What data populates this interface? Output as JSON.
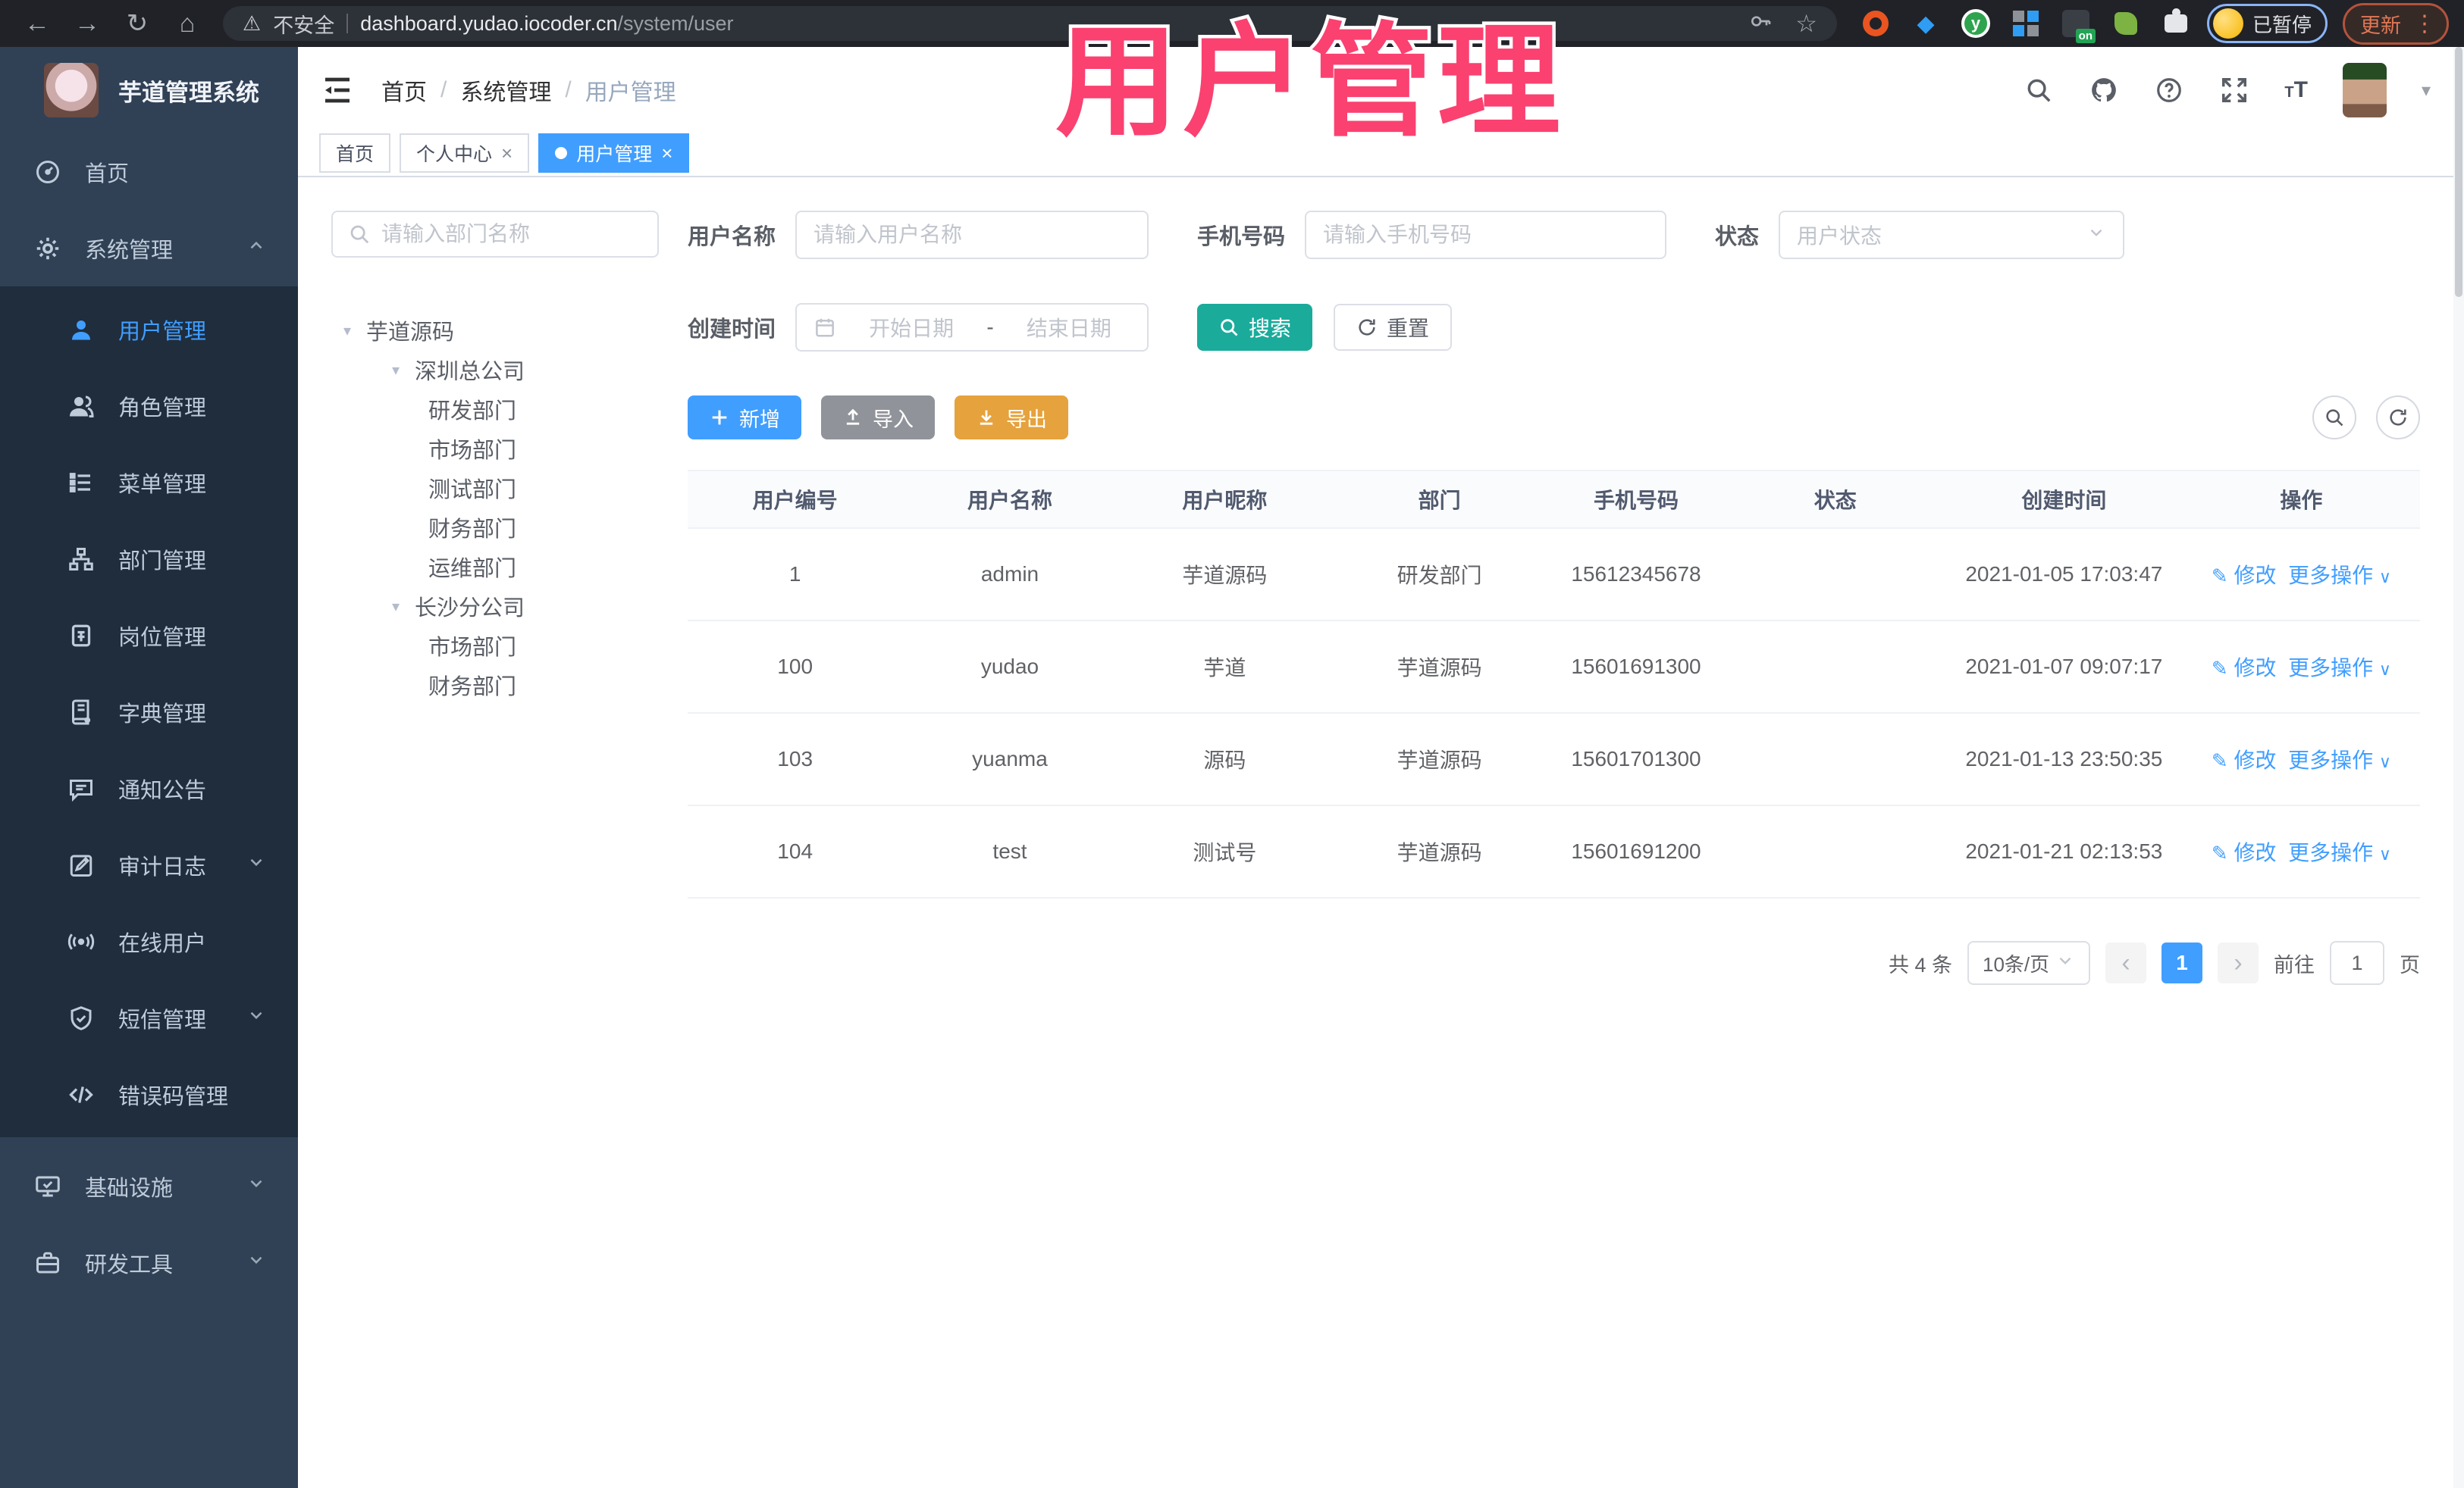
{
  "colors": {
    "accent": "#409EFF",
    "search_teal": "#1AAB9B",
    "export_orange": "#E6A23C",
    "import_gray": "#909399",
    "overlay_pink": "#FA4170",
    "sidebar_bg": "#304156",
    "submenu_bg": "#1F2D3D"
  },
  "browser": {
    "security": "不安全",
    "host": "dashboard.yudao.iocoder.cn",
    "path": "/system/user",
    "profile_status": "已暂停",
    "update": "更新"
  },
  "overlay_title": "用户管理",
  "sidebar": {
    "app_title": "芋道管理系统",
    "top": [
      {
        "label": "首页"
      },
      {
        "label": "系统管理"
      }
    ],
    "submenu": [
      {
        "label": "用户管理"
      },
      {
        "label": "角色管理"
      },
      {
        "label": "菜单管理"
      },
      {
        "label": "部门管理"
      },
      {
        "label": "岗位管理"
      },
      {
        "label": "字典管理"
      },
      {
        "label": "通知公告"
      },
      {
        "label": "审计日志"
      },
      {
        "label": "在线用户"
      },
      {
        "label": "短信管理"
      },
      {
        "label": "错误码管理"
      }
    ],
    "bottom": [
      {
        "label": "基础设施"
      },
      {
        "label": "研发工具"
      }
    ]
  },
  "header": {
    "breadcrumb": [
      "首页",
      "系统管理",
      "用户管理"
    ]
  },
  "tabs": [
    {
      "label": "首页"
    },
    {
      "label": "个人中心"
    },
    {
      "label": "用户管理"
    }
  ],
  "dept": {
    "search_placeholder": "请输入部门名称",
    "nodes": [
      {
        "label": "芋道源码"
      },
      {
        "label": "深圳总公司"
      },
      {
        "label": "研发部门"
      },
      {
        "label": "市场部门"
      },
      {
        "label": "测试部门"
      },
      {
        "label": "财务部门"
      },
      {
        "label": "运维部门"
      },
      {
        "label": "长沙分公司"
      },
      {
        "label": "市场部门"
      },
      {
        "label": "财务部门"
      }
    ]
  },
  "filters": {
    "username_label": "用户名称",
    "username_placeholder": "请输入用户名称",
    "mobile_label": "手机号码",
    "mobile_placeholder": "请输入手机号码",
    "status_label": "状态",
    "status_placeholder": "用户状态",
    "created_label": "创建时间",
    "date_start_placeholder": "开始日期",
    "date_separator": "-",
    "date_end_placeholder": "结束日期",
    "search": "搜索",
    "reset": "重置"
  },
  "toolbar": {
    "add": "新增",
    "import": "导入",
    "export": "导出"
  },
  "table": {
    "headers": [
      "用户编号",
      "用户名称",
      "用户昵称",
      "部门",
      "手机号码",
      "状态",
      "创建时间",
      "操作"
    ],
    "actions": {
      "edit": "修改",
      "more": "更多操作"
    },
    "rows": [
      {
        "id": "1",
        "username": "admin",
        "nickname": "芋道源码",
        "dept": "研发部门",
        "mobile": "15612345678",
        "status_on": true,
        "created": "2021-01-05 17:03:47"
      },
      {
        "id": "100",
        "username": "yudao",
        "nickname": "芋道",
        "dept": "芋道源码",
        "mobile": "15601691300",
        "status_on": false,
        "created": "2021-01-07 09:07:17"
      },
      {
        "id": "103",
        "username": "yuanma",
        "nickname": "源码",
        "dept": "芋道源码",
        "mobile": "15601701300",
        "status_on": true,
        "created": "2021-01-13 23:50:35"
      },
      {
        "id": "104",
        "username": "test",
        "nickname": "测试号",
        "dept": "芋道源码",
        "mobile": "15601691200",
        "status_on": true,
        "created": "2021-01-21 02:13:53"
      }
    ]
  },
  "pagination": {
    "total": "共 4 条",
    "page_size": "10条/页",
    "current": "1",
    "goto": "前往",
    "goto_value": "1",
    "unit": "页"
  }
}
